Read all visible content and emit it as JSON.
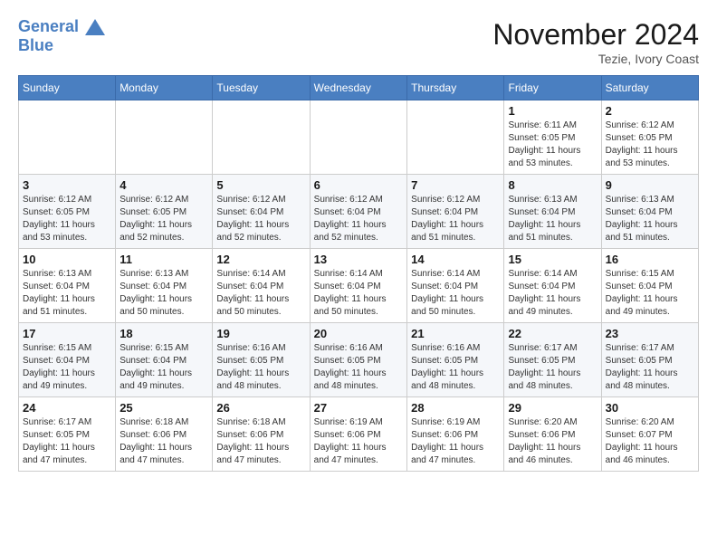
{
  "logo": {
    "line1": "General",
    "line2": "Blue"
  },
  "title": "November 2024",
  "location": "Tezie, Ivory Coast",
  "days_of_week": [
    "Sunday",
    "Monday",
    "Tuesday",
    "Wednesday",
    "Thursday",
    "Friday",
    "Saturday"
  ],
  "weeks": [
    [
      {
        "day": "",
        "info": ""
      },
      {
        "day": "",
        "info": ""
      },
      {
        "day": "",
        "info": ""
      },
      {
        "day": "",
        "info": ""
      },
      {
        "day": "",
        "info": ""
      },
      {
        "day": "1",
        "info": "Sunrise: 6:11 AM\nSunset: 6:05 PM\nDaylight: 11 hours and 53 minutes."
      },
      {
        "day": "2",
        "info": "Sunrise: 6:12 AM\nSunset: 6:05 PM\nDaylight: 11 hours and 53 minutes."
      }
    ],
    [
      {
        "day": "3",
        "info": "Sunrise: 6:12 AM\nSunset: 6:05 PM\nDaylight: 11 hours and 53 minutes."
      },
      {
        "day": "4",
        "info": "Sunrise: 6:12 AM\nSunset: 6:05 PM\nDaylight: 11 hours and 52 minutes."
      },
      {
        "day": "5",
        "info": "Sunrise: 6:12 AM\nSunset: 6:04 PM\nDaylight: 11 hours and 52 minutes."
      },
      {
        "day": "6",
        "info": "Sunrise: 6:12 AM\nSunset: 6:04 PM\nDaylight: 11 hours and 52 minutes."
      },
      {
        "day": "7",
        "info": "Sunrise: 6:12 AM\nSunset: 6:04 PM\nDaylight: 11 hours and 51 minutes."
      },
      {
        "day": "8",
        "info": "Sunrise: 6:13 AM\nSunset: 6:04 PM\nDaylight: 11 hours and 51 minutes."
      },
      {
        "day": "9",
        "info": "Sunrise: 6:13 AM\nSunset: 6:04 PM\nDaylight: 11 hours and 51 minutes."
      }
    ],
    [
      {
        "day": "10",
        "info": "Sunrise: 6:13 AM\nSunset: 6:04 PM\nDaylight: 11 hours and 51 minutes."
      },
      {
        "day": "11",
        "info": "Sunrise: 6:13 AM\nSunset: 6:04 PM\nDaylight: 11 hours and 50 minutes."
      },
      {
        "day": "12",
        "info": "Sunrise: 6:14 AM\nSunset: 6:04 PM\nDaylight: 11 hours and 50 minutes."
      },
      {
        "day": "13",
        "info": "Sunrise: 6:14 AM\nSunset: 6:04 PM\nDaylight: 11 hours and 50 minutes."
      },
      {
        "day": "14",
        "info": "Sunrise: 6:14 AM\nSunset: 6:04 PM\nDaylight: 11 hours and 50 minutes."
      },
      {
        "day": "15",
        "info": "Sunrise: 6:14 AM\nSunset: 6:04 PM\nDaylight: 11 hours and 49 minutes."
      },
      {
        "day": "16",
        "info": "Sunrise: 6:15 AM\nSunset: 6:04 PM\nDaylight: 11 hours and 49 minutes."
      }
    ],
    [
      {
        "day": "17",
        "info": "Sunrise: 6:15 AM\nSunset: 6:04 PM\nDaylight: 11 hours and 49 minutes."
      },
      {
        "day": "18",
        "info": "Sunrise: 6:15 AM\nSunset: 6:04 PM\nDaylight: 11 hours and 49 minutes."
      },
      {
        "day": "19",
        "info": "Sunrise: 6:16 AM\nSunset: 6:05 PM\nDaylight: 11 hours and 48 minutes."
      },
      {
        "day": "20",
        "info": "Sunrise: 6:16 AM\nSunset: 6:05 PM\nDaylight: 11 hours and 48 minutes."
      },
      {
        "day": "21",
        "info": "Sunrise: 6:16 AM\nSunset: 6:05 PM\nDaylight: 11 hours and 48 minutes."
      },
      {
        "day": "22",
        "info": "Sunrise: 6:17 AM\nSunset: 6:05 PM\nDaylight: 11 hours and 48 minutes."
      },
      {
        "day": "23",
        "info": "Sunrise: 6:17 AM\nSunset: 6:05 PM\nDaylight: 11 hours and 48 minutes."
      }
    ],
    [
      {
        "day": "24",
        "info": "Sunrise: 6:17 AM\nSunset: 6:05 PM\nDaylight: 11 hours and 47 minutes."
      },
      {
        "day": "25",
        "info": "Sunrise: 6:18 AM\nSunset: 6:06 PM\nDaylight: 11 hours and 47 minutes."
      },
      {
        "day": "26",
        "info": "Sunrise: 6:18 AM\nSunset: 6:06 PM\nDaylight: 11 hours and 47 minutes."
      },
      {
        "day": "27",
        "info": "Sunrise: 6:19 AM\nSunset: 6:06 PM\nDaylight: 11 hours and 47 minutes."
      },
      {
        "day": "28",
        "info": "Sunrise: 6:19 AM\nSunset: 6:06 PM\nDaylight: 11 hours and 47 minutes."
      },
      {
        "day": "29",
        "info": "Sunrise: 6:20 AM\nSunset: 6:06 PM\nDaylight: 11 hours and 46 minutes."
      },
      {
        "day": "30",
        "info": "Sunrise: 6:20 AM\nSunset: 6:07 PM\nDaylight: 11 hours and 46 minutes."
      }
    ]
  ]
}
